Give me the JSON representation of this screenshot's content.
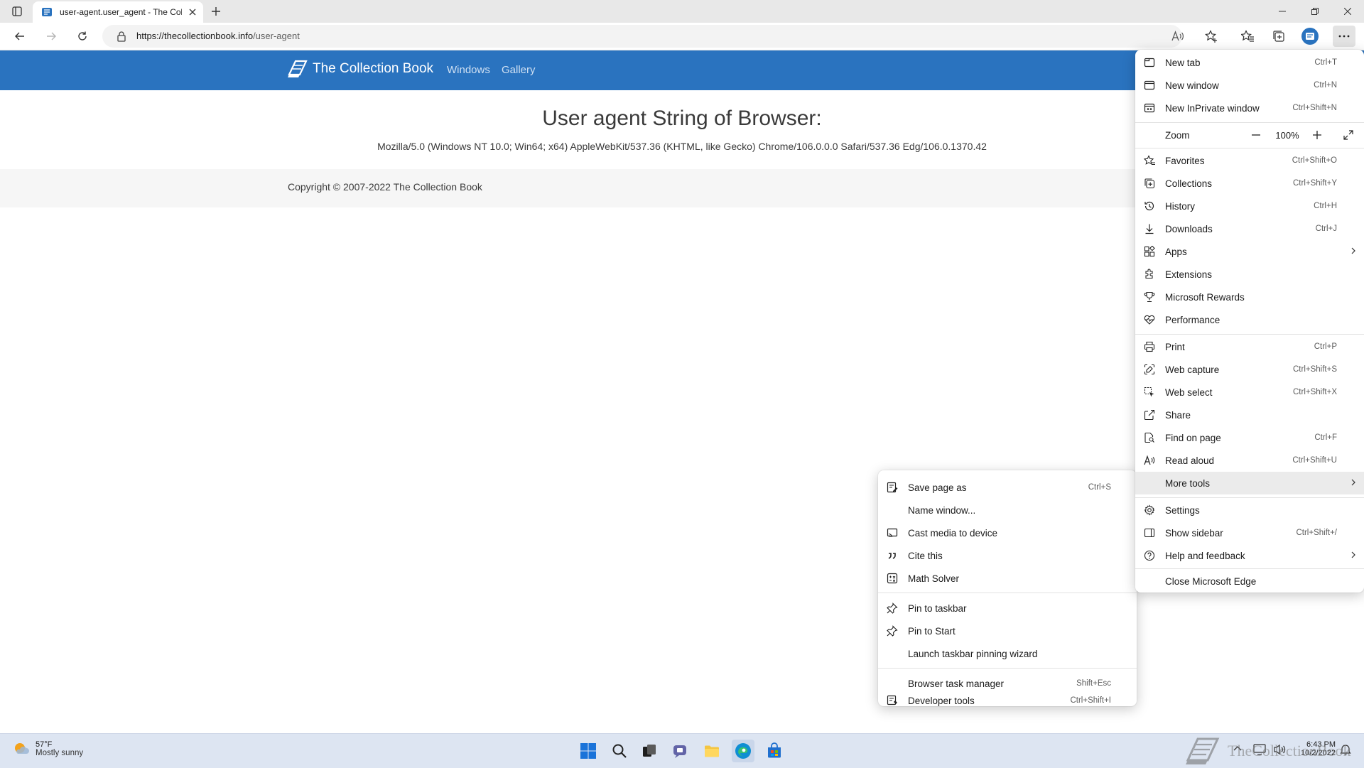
{
  "browser": {
    "tab_title": "user-agent.user_agent - The Coll",
    "url_host": "https://thecollectionbook.info",
    "url_path": "/user-agent"
  },
  "site": {
    "brand": "The Collection Book",
    "nav": [
      "Windows",
      "Gallery"
    ],
    "page_title": "User agent String of Browser:",
    "ua_string": "Mozilla/5.0 (Windows NT 10.0; Win64; x64) AppleWebKit/537.36 (KHTML, like Gecko) Chrome/106.0.0.0 Safari/537.36 Edg/106.0.1370.42",
    "copyright": "Copyright © 2007-2022 The Collection Book",
    "header_color": "#2a73bf"
  },
  "main_menu": {
    "new_tab": {
      "label": "New tab",
      "shortcut": "Ctrl+T"
    },
    "new_window": {
      "label": "New window",
      "shortcut": "Ctrl+N"
    },
    "new_inprivate": {
      "label": "New InPrivate window",
      "shortcut": "Ctrl+Shift+N"
    },
    "zoom": {
      "label": "Zoom",
      "value": "100%"
    },
    "favorites": {
      "label": "Favorites",
      "shortcut": "Ctrl+Shift+O"
    },
    "collections": {
      "label": "Collections",
      "shortcut": "Ctrl+Shift+Y"
    },
    "history": {
      "label": "History",
      "shortcut": "Ctrl+H"
    },
    "downloads": {
      "label": "Downloads",
      "shortcut": "Ctrl+J"
    },
    "apps": {
      "label": "Apps"
    },
    "extensions": {
      "label": "Extensions"
    },
    "rewards": {
      "label": "Microsoft Rewards"
    },
    "performance": {
      "label": "Performance"
    },
    "print": {
      "label": "Print",
      "shortcut": "Ctrl+P"
    },
    "web_capture": {
      "label": "Web capture",
      "shortcut": "Ctrl+Shift+S"
    },
    "web_select": {
      "label": "Web select",
      "shortcut": "Ctrl+Shift+X"
    },
    "share": {
      "label": "Share"
    },
    "find": {
      "label": "Find on page",
      "shortcut": "Ctrl+F"
    },
    "read_aloud": {
      "label": "Read aloud",
      "shortcut": "Ctrl+Shift+U"
    },
    "more_tools": {
      "label": "More tools"
    },
    "settings": {
      "label": "Settings"
    },
    "show_sidebar": {
      "label": "Show sidebar",
      "shortcut": "Ctrl+Shift+/"
    },
    "help": {
      "label": "Help and feedback"
    },
    "close_edge": {
      "label": "Close Microsoft Edge"
    }
  },
  "more_tools_menu": {
    "save_page": {
      "label": "Save page as",
      "shortcut": "Ctrl+S"
    },
    "name_window": {
      "label": "Name window..."
    },
    "cast": {
      "label": "Cast media to device"
    },
    "cite": {
      "label": "Cite this"
    },
    "math": {
      "label": "Math Solver"
    },
    "pin_taskbar": {
      "label": "Pin to taskbar"
    },
    "pin_start": {
      "label": "Pin to Start"
    },
    "pin_wizard": {
      "label": "Launch taskbar pinning wizard"
    },
    "task_manager": {
      "label": "Browser task manager",
      "shortcut": "Shift+Esc"
    },
    "devtools": {
      "label": "Developer tools",
      "shortcut": "Ctrl+Shift+I"
    }
  },
  "taskbar": {
    "weather_temp": "57°F",
    "weather_desc": "Mostly sunny",
    "time": "6:43 PM",
    "date": "10/2/2022",
    "watermark": "TheCollectionBook"
  }
}
